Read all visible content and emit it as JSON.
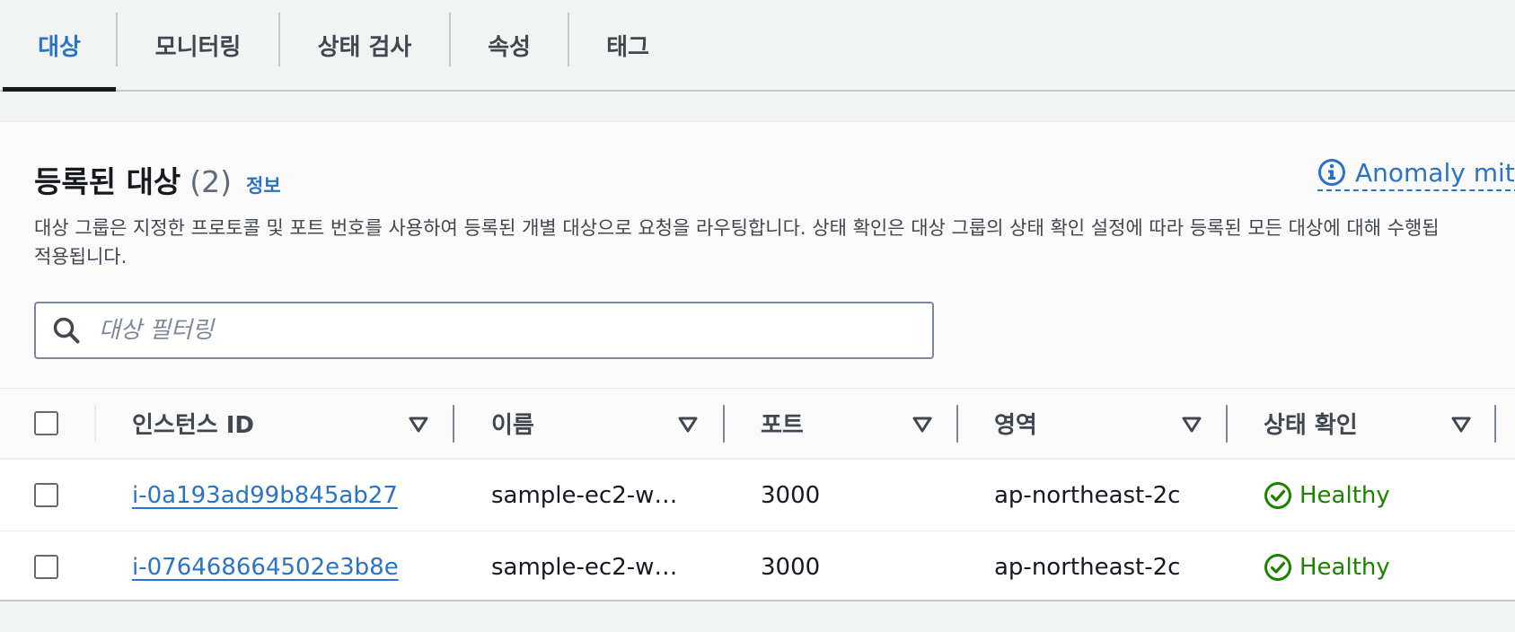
{
  "tabs": [
    {
      "label": "대상",
      "active": true
    },
    {
      "label": "모니터링",
      "active": false
    },
    {
      "label": "상태 검사",
      "active": false
    },
    {
      "label": "속성",
      "active": false
    },
    {
      "label": "태그",
      "active": false
    }
  ],
  "section": {
    "title": "등록된 대상",
    "count": "(2)",
    "info_link": "정보",
    "anomaly_link": "Anomaly mitig",
    "description_line1": "대상 그룹은 지정한 프로토콜 및 포트 번호를 사용하여 등록된 개별 대상으로 요청을 라우팅합니다. 상태 확인은 대상 그룹의 상태 확인 설정에 따라 등록된 모든 대상에 대해 수행됩",
    "description_line2": "적용됩니다."
  },
  "search": {
    "placeholder": "대상 필터링",
    "value": ""
  },
  "table": {
    "columns": [
      "인스턴스 ID",
      "이름",
      "포트",
      "영역",
      "상태 확인"
    ],
    "rows": [
      {
        "instance_id": "i-0a193ad99b845ab27",
        "name": "sample-ec2-w…",
        "port": "3000",
        "zone": "ap-northeast-2c",
        "health": "Healthy"
      },
      {
        "instance_id": "i-076468664502e3b8e",
        "name": "sample-ec2-w…",
        "port": "3000",
        "zone": "ap-northeast-2c",
        "health": "Healthy"
      }
    ]
  },
  "colors": {
    "link": "#2a73c5",
    "healthy": "#1d8102",
    "active_tab_indicator": "#16191f"
  },
  "icons": {
    "search": "search-icon",
    "info": "info-icon",
    "sort": "sort-down-icon",
    "healthy": "check-circle-icon"
  }
}
